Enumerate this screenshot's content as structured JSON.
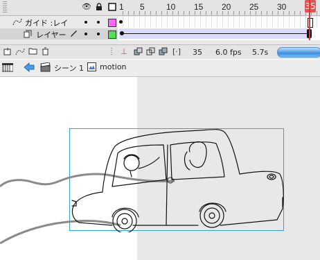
{
  "timeline": {
    "header_icons": [
      "eye-icon",
      "lock-icon",
      "outline-square-icon"
    ],
    "ruler_numbers": [
      "1",
      "5",
      "10",
      "15",
      "20",
      "25",
      "30",
      "35"
    ],
    "playhead_frame": "35",
    "layers": [
      {
        "name": "ガイド :レイ",
        "icon": "guide-layer-icon",
        "color": "#ff66ff"
      },
      {
        "name": "レイヤー",
        "icon": "layer-icon",
        "color": "#55dd55"
      }
    ],
    "footer": {
      "current_frame": "35",
      "fps": "6.0 fps",
      "elapsed": "5.7s"
    }
  },
  "editbar": {
    "scene_label": "シーン 1",
    "symbol_label": "motion"
  },
  "stage": {
    "selection_color": "#2ea6c4",
    "gray_color": "#e8e8e8"
  }
}
